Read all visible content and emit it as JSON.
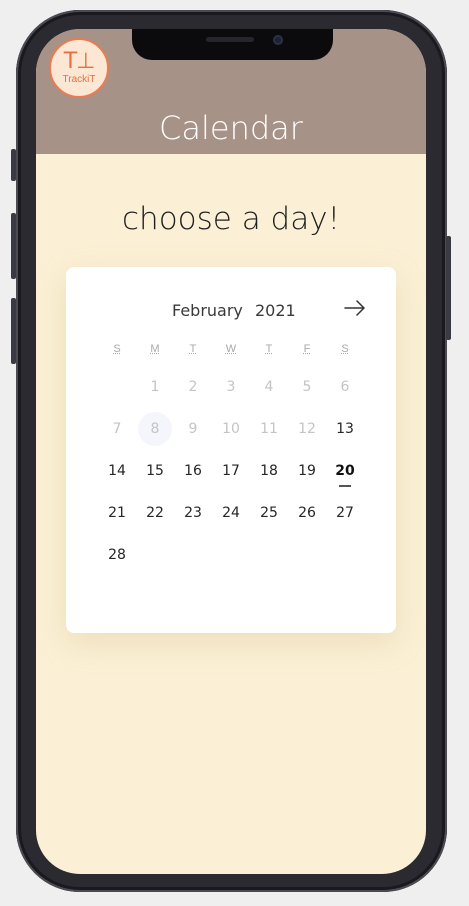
{
  "app": {
    "logo_mark": "T⊥",
    "logo_text": "TrackiT",
    "title": "Calendar"
  },
  "main": {
    "prompt": "choose a day!"
  },
  "calendar": {
    "month": "February",
    "year": "2021",
    "weekdays": [
      "S",
      "M",
      "T",
      "W",
      "T",
      "F",
      "S"
    ],
    "weeks": [
      [
        "",
        "1",
        "2",
        "3",
        "4",
        "5",
        "6"
      ],
      [
        "7",
        "8",
        "9",
        "10",
        "11",
        "12",
        "13"
      ],
      [
        "14",
        "15",
        "16",
        "17",
        "18",
        "19",
        "20"
      ],
      [
        "21",
        "22",
        "23",
        "24",
        "25",
        "26",
        "27"
      ],
      [
        "28",
        "",
        "",
        "",
        "",
        "",
        ""
      ]
    ],
    "disabled_days": [
      "1",
      "2",
      "3",
      "4",
      "5",
      "6",
      "7",
      "8",
      "9",
      "10",
      "11",
      "12"
    ],
    "today": "20",
    "highlighted": "8",
    "next_icon": "arrow-right-icon"
  },
  "colors": {
    "header": "#a79287",
    "background": "#fbf0d5",
    "logo_accent": "#ea7b52"
  }
}
